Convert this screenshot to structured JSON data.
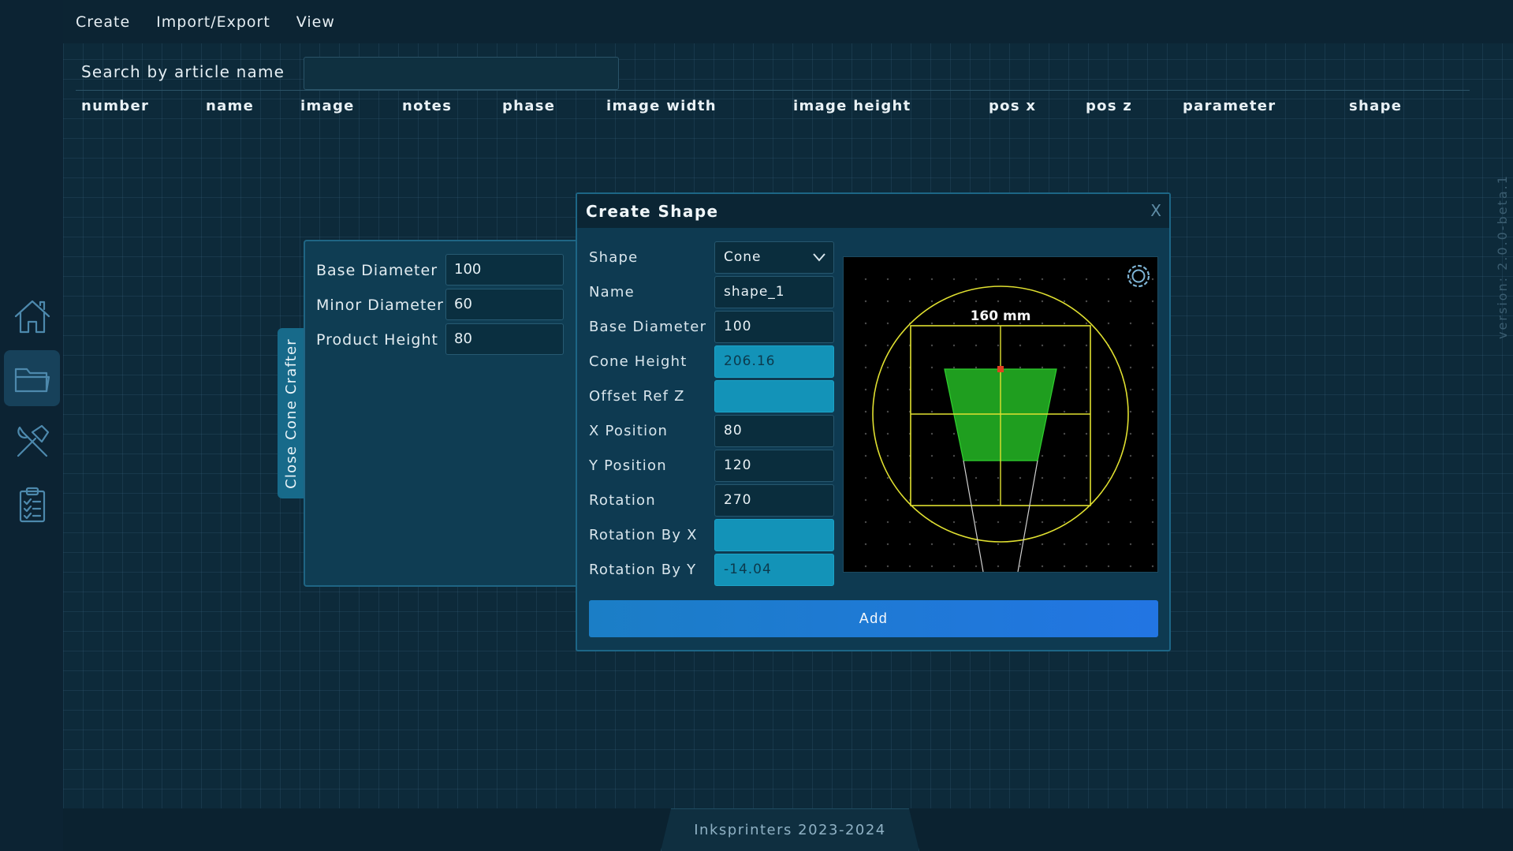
{
  "menu": {
    "create": "Create",
    "import_export": "Import/Export",
    "view": "View"
  },
  "sidebar": {
    "items": [
      "home-icon",
      "folder-icon",
      "tools-icon",
      "clipboard-icon"
    ],
    "active": "folder-icon"
  },
  "search": {
    "label": "Search by article name",
    "value": "",
    "placeholder": ""
  },
  "table": {
    "columns": [
      "number",
      "name",
      "image",
      "notes",
      "phase",
      "image width",
      "image height",
      "pos x",
      "pos z",
      "parameter",
      "shape"
    ]
  },
  "cone_crafter": {
    "tab_label": "Close Cone Crafter",
    "fields": [
      {
        "label": "Base Diameter",
        "value": "100"
      },
      {
        "label": "Minor Diameter",
        "value": "60"
      },
      {
        "label": "Product Height",
        "value": "80"
      }
    ]
  },
  "dialog": {
    "title": "Create Shape",
    "close_label": "X",
    "fields": [
      {
        "label": "Shape",
        "value": "Cone"
      },
      {
        "label": "Name",
        "value": "shape_1"
      },
      {
        "label": "Base Diameter",
        "value": "100"
      },
      {
        "label": "Cone Height",
        "value": "206.16"
      },
      {
        "label": "Offset Ref Z",
        "value": ""
      },
      {
        "label": "X Position",
        "value": "80"
      },
      {
        "label": "Y Position",
        "value": "120"
      },
      {
        "label": "Rotation",
        "value": "270"
      },
      {
        "label": "Rotation By X",
        "value": ""
      },
      {
        "label": "Rotation By Y",
        "value": "-14.04"
      }
    ],
    "preview": {
      "dimension_label": "160 mm"
    },
    "add_label": "Add"
  },
  "version": "version: 2.0.0-beta.1",
  "footer": "Inksprinters 2023-2024",
  "colors": {
    "accent": "#1393b8",
    "button": "#2275e3",
    "shape_fill": "#1f9e1f",
    "outline": "#e0e030"
  }
}
